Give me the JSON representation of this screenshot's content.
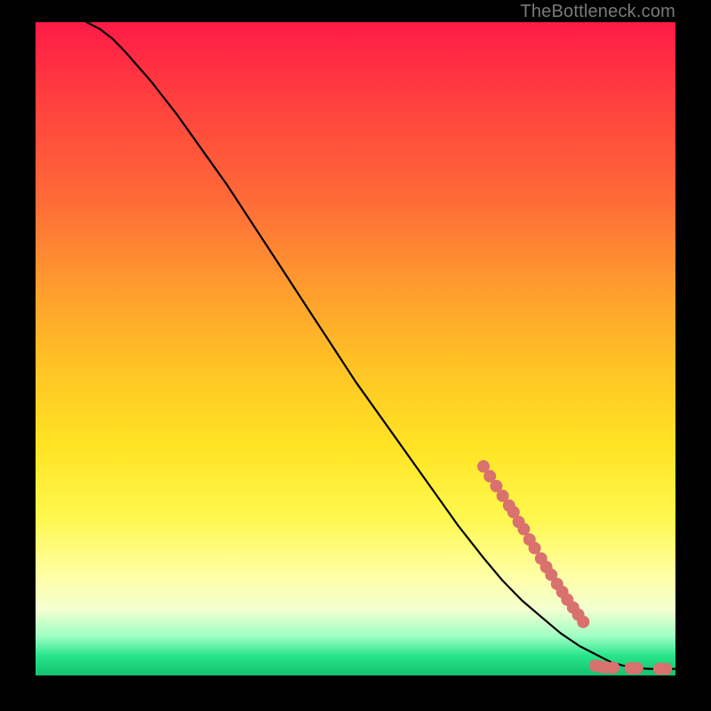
{
  "watermark": "TheBottleneck.com",
  "colors": {
    "background": "#000000",
    "curve": "#000000",
    "marker": "#d9716e",
    "gradient_top": "#ff1a47",
    "gradient_mid": "#ffe423",
    "gradient_bottom": "#13c06e"
  },
  "chart_data": {
    "type": "line",
    "title": "",
    "xlabel": "",
    "ylabel": "",
    "xlim": [
      0,
      100
    ],
    "ylim": [
      0,
      100
    ],
    "grid": false,
    "legend": false,
    "series": [
      {
        "name": "bottleneck-curve",
        "x": [
          8,
          10,
          12,
          14,
          18,
          22,
          26,
          30,
          34,
          38,
          42,
          46,
          50,
          54,
          58,
          62,
          66,
          70,
          73,
          76,
          79,
          82,
          85,
          88,
          90,
          93,
          96,
          100
        ],
        "y": [
          100,
          99,
          97.5,
          95.5,
          91,
          86,
          80.5,
          75,
          69,
          63,
          57,
          51,
          45,
          39.5,
          34,
          28.5,
          23,
          18,
          14.5,
          11.5,
          9,
          6.5,
          4.5,
          3,
          2,
          1.2,
          1,
          1
        ]
      }
    ],
    "markers": [
      {
        "x": 70,
        "y": 32
      },
      {
        "x": 71,
        "y": 30.5
      },
      {
        "x": 72,
        "y": 29
      },
      {
        "x": 73,
        "y": 27.5
      },
      {
        "x": 74,
        "y": 26
      },
      {
        "x": 74.7,
        "y": 25
      },
      {
        "x": 75.5,
        "y": 23.5
      },
      {
        "x": 76.3,
        "y": 22.4
      },
      {
        "x": 77.2,
        "y": 20.8
      },
      {
        "x": 78,
        "y": 19.5
      },
      {
        "x": 79,
        "y": 17.9
      },
      {
        "x": 79.8,
        "y": 16.6
      },
      {
        "x": 80.6,
        "y": 15.4
      },
      {
        "x": 81.5,
        "y": 14
      },
      {
        "x": 82.3,
        "y": 12.8
      },
      {
        "x": 83.1,
        "y": 11.6
      },
      {
        "x": 84,
        "y": 10.4
      },
      {
        "x": 84.8,
        "y": 9.3
      },
      {
        "x": 85.6,
        "y": 8.2
      },
      {
        "x": 87.5,
        "y": 1.5
      },
      {
        "x": 88.5,
        "y": 1.3
      },
      {
        "x": 89.3,
        "y": 1.2
      },
      {
        "x": 90.3,
        "y": 1.2
      },
      {
        "x": 93,
        "y": 1.1
      },
      {
        "x": 94,
        "y": 1.1
      },
      {
        "x": 97.5,
        "y": 1
      },
      {
        "x": 98.5,
        "y": 1
      }
    ]
  }
}
